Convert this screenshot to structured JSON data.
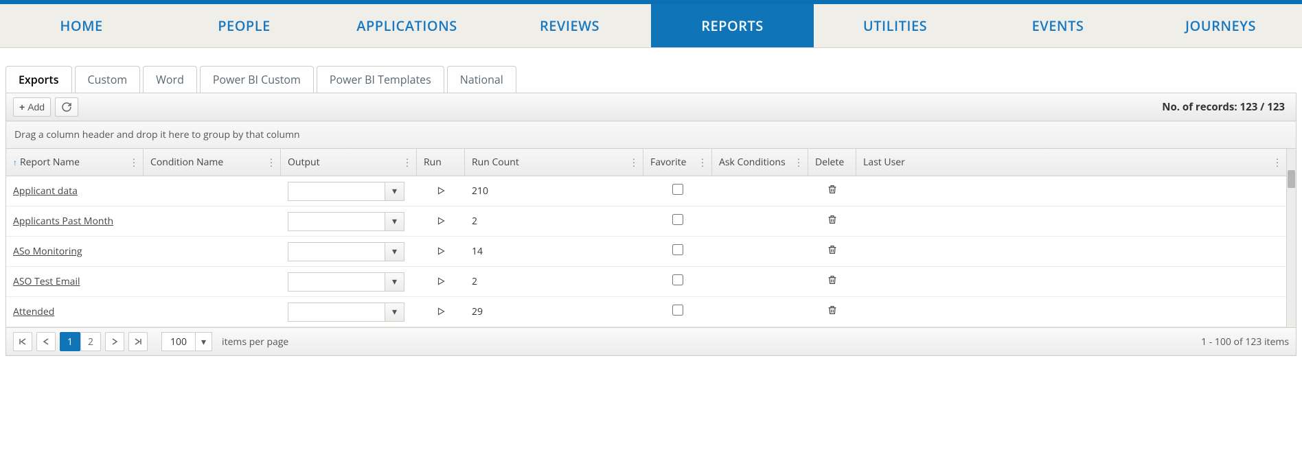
{
  "nav": [
    {
      "label": "HOME",
      "active": false
    },
    {
      "label": "PEOPLE",
      "active": false
    },
    {
      "label": "APPLICATIONS",
      "active": false
    },
    {
      "label": "REVIEWS",
      "active": false
    },
    {
      "label": "REPORTS",
      "active": true
    },
    {
      "label": "UTILITIES",
      "active": false
    },
    {
      "label": "EVENTS",
      "active": false
    },
    {
      "label": "JOURNEYS",
      "active": false
    }
  ],
  "tabs": [
    {
      "label": "Exports",
      "active": true
    },
    {
      "label": "Custom",
      "active": false
    },
    {
      "label": "Word",
      "active": false
    },
    {
      "label": "Power BI Custom",
      "active": false
    },
    {
      "label": "Power BI Templates",
      "active": false
    },
    {
      "label": "National",
      "active": false
    }
  ],
  "toolbar": {
    "add_label": "Add",
    "records_label": "No. of records: 123 / 123"
  },
  "group_hint": "Drag a column header and drop it here to group by that column",
  "columns": {
    "report_name": "Report Name",
    "condition_name": "Condition Name",
    "output": "Output",
    "run": "Run",
    "run_count": "Run Count",
    "favorite": "Favorite",
    "ask_conditions": "Ask Conditions",
    "delete": "Delete",
    "last_user": "Last User"
  },
  "rows": [
    {
      "name": "Applicant data",
      "condition": "",
      "output": "",
      "run_count": "210",
      "favorite": false,
      "ask": "",
      "last_user": ""
    },
    {
      "name": "Applicants Past Month",
      "condition": "",
      "output": "",
      "run_count": "2",
      "favorite": false,
      "ask": "",
      "last_user": ""
    },
    {
      "name": "ASo Monitoring",
      "condition": "",
      "output": "",
      "run_count": "14",
      "favorite": false,
      "ask": "",
      "last_user": ""
    },
    {
      "name": "ASO Test Email",
      "condition": "",
      "output": "",
      "run_count": "2",
      "favorite": false,
      "ask": "",
      "last_user": ""
    },
    {
      "name": "Attended",
      "condition": "",
      "output": "",
      "run_count": "29",
      "favorite": false,
      "ask": "",
      "last_user": ""
    }
  ],
  "pager": {
    "pages": [
      {
        "label": "1",
        "active": true
      },
      {
        "label": "2",
        "active": false
      }
    ],
    "page_size": "100",
    "page_size_label": "items per page",
    "summary": "1 - 100 of 123 items"
  }
}
